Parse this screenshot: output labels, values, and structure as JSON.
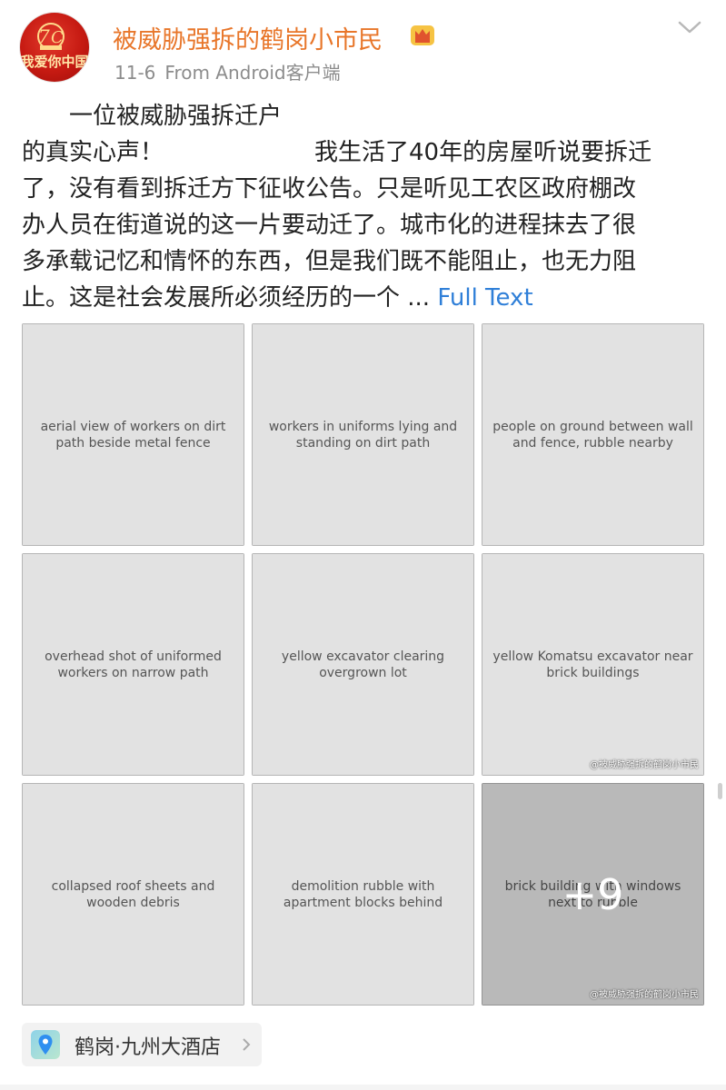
{
  "header": {
    "avatar_text": "我爱你中国",
    "avatar_emblem_text": "70",
    "username": "被威胁强拆的鹤岗小市民",
    "date": "11-6",
    "source": "From Android客户端"
  },
  "post": {
    "lines": [
      "一位被威胁强拆迁户",
      "的真实心声！",
      "我生活了40年的房屋听说要拆迁",
      "了，没有看到拆迁方下征收公告。只是听见工农区政府棚改",
      "办人员在街道说的这一片要动迁了。城市化的进程抹去了很",
      "多承载记忆和情怀的东西，但是我们既不能阻止，也无力阻",
      "止。这是社会发展所必须经历的一个 ..."
    ],
    "full_text_label": "Full Text"
  },
  "photos": {
    "watermark": "@被威胁强拆的鹤岗小市民",
    "more_count": "+9",
    "captions": [
      "aerial view of workers on dirt path beside metal fence",
      "workers in uniforms lying and standing on dirt path",
      "people on ground between wall and fence, rubble nearby",
      "overhead shot of uniformed workers on narrow path",
      "yellow excavator clearing overgrown lot",
      "yellow Komatsu excavator near brick buildings",
      "collapsed roof sheets and wooden debris",
      "demolition rubble with apartment blocks behind",
      "brick building with windows next to rubble"
    ]
  },
  "location": {
    "label": "鹤岗·九州大酒店"
  },
  "colors": {
    "username": "#e8762a",
    "link": "#2f7fd8",
    "meta": "#8c8c8c"
  }
}
